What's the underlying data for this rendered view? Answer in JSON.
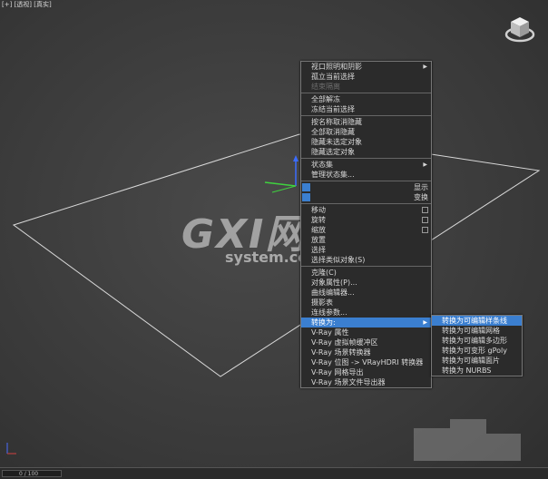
{
  "viewport": {
    "label": "[+] [透视] [真实]"
  },
  "colors": {
    "accent": "#3b7fd0",
    "menu_bg": "#2b2b2b",
    "wire": "#d8d8d8"
  },
  "quad_menu": {
    "group1": [
      {
        "label": "视口照明和阴影",
        "submenu": true,
        "disabled": false
      },
      {
        "label": "孤立当前选择",
        "disabled": false
      },
      {
        "label": "结束隔离",
        "disabled": true
      }
    ],
    "group2": [
      {
        "label": "全部解冻",
        "disabled": false
      },
      {
        "label": "冻结当前选择",
        "disabled": false
      }
    ],
    "group3": [
      {
        "label": "按名称取消隐藏",
        "disabled": false
      },
      {
        "label": "全部取消隐藏",
        "disabled": false
      },
      {
        "label": "隐藏未选定对象",
        "disabled": false
      },
      {
        "label": "隐藏选定对象",
        "disabled": false
      }
    ],
    "group4": [
      {
        "label": "状态集",
        "submenu": true,
        "disabled": false
      },
      {
        "label": "管理状态集...",
        "disabled": false
      }
    ],
    "display_label": "显示",
    "transform_label": "变换",
    "group5": [
      {
        "label": "移动",
        "check": true
      },
      {
        "label": "旋转",
        "check": true
      },
      {
        "label": "缩放",
        "check": true
      },
      {
        "label": "放置",
        "check": false
      },
      {
        "label": "选择",
        "check": false
      },
      {
        "label": "选择类似对象(S)",
        "check": false
      }
    ],
    "group6": [
      {
        "label": "克隆(C)"
      },
      {
        "label": "对象属性(P)..."
      },
      {
        "label": "曲线编辑器..."
      },
      {
        "label": "摄影表"
      },
      {
        "label": "连线参数..."
      }
    ],
    "convert_label": "转换为:",
    "group7": [
      {
        "label": "V-Ray 属性"
      },
      {
        "label": "V-Ray 虚拟帧缓冲区"
      },
      {
        "label": "V-Ray 场景转换器"
      },
      {
        "label": "V-Ray 位图 -> VRayHDRI 转换器"
      },
      {
        "label": "V-Ray 网格导出"
      },
      {
        "label": "V-Ray 场景文件导出器"
      }
    ]
  },
  "convert_submenu": {
    "items": [
      {
        "label": "转换为可编辑样条线",
        "selected": true
      },
      {
        "label": "转换为可编辑网格",
        "selected": false
      },
      {
        "label": "转换为可编辑多边形",
        "selected": false
      },
      {
        "label": "转换为可变形 gPoly",
        "selected": false
      },
      {
        "label": "转换为可编辑面片",
        "selected": false
      },
      {
        "label": "转换为 NURBS",
        "selected": false
      }
    ]
  },
  "watermark": {
    "main": "GXI网",
    "sub": "system.com"
  },
  "statusbar": {
    "frame": "0 / 100"
  }
}
